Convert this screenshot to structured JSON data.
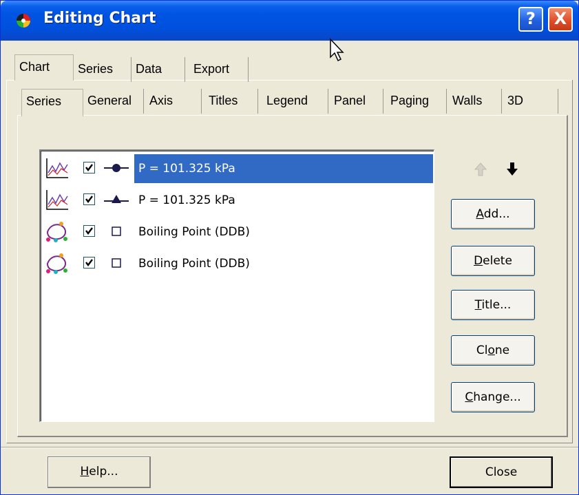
{
  "window": {
    "title": "Editing Chart",
    "help_glyph": "?",
    "close_glyph": "X"
  },
  "top_tabs": [
    {
      "label": "Chart",
      "active": true
    },
    {
      "label": "Series"
    },
    {
      "label": "Data"
    },
    {
      "label": "Export"
    }
  ],
  "sub_tabs": [
    {
      "label": "Series",
      "active": true
    },
    {
      "label": "General"
    },
    {
      "label": "Axis"
    },
    {
      "label": "Titles"
    },
    {
      "label": "Legend"
    },
    {
      "label": "Panel"
    },
    {
      "label": "Paging"
    },
    {
      "label": "Walls"
    },
    {
      "label": "3D"
    }
  ],
  "series_list": [
    {
      "label": "P = 101.325 kPa",
      "checked": true,
      "selected": true,
      "chart_icon": "line-chart-icon",
      "marker": "circle-marker-icon"
    },
    {
      "label": "P = 101.325 kPa",
      "checked": true,
      "selected": false,
      "chart_icon": "line-chart-icon",
      "marker": "triangle-marker-icon"
    },
    {
      "label": "Boiling Point (DDB)",
      "checked": true,
      "selected": false,
      "chart_icon": "point-chart-icon",
      "marker": "square-marker-icon"
    },
    {
      "label": "Boiling Point (DDB)",
      "checked": true,
      "selected": false,
      "chart_icon": "point-chart-icon",
      "marker": "square-marker-icon"
    }
  ],
  "buttons": {
    "add": {
      "pre": "",
      "ul": "A",
      "post": "dd..."
    },
    "delete": {
      "pre": "",
      "ul": "D",
      "post": "elete"
    },
    "title": {
      "pre": "",
      "ul": "T",
      "post": "itle..."
    },
    "clone": {
      "pre": "Cl",
      "ul": "o",
      "post": "ne"
    },
    "change": {
      "pre": "",
      "ul": "C",
      "post": "hange..."
    },
    "help": {
      "pre": "",
      "ul": "H",
      "post": "elp..."
    },
    "close": {
      "label": "Close"
    }
  },
  "colors": {
    "titlebar": "#0054e3",
    "selection": "#316ac5",
    "dialog_bg": "#ece9d8"
  }
}
